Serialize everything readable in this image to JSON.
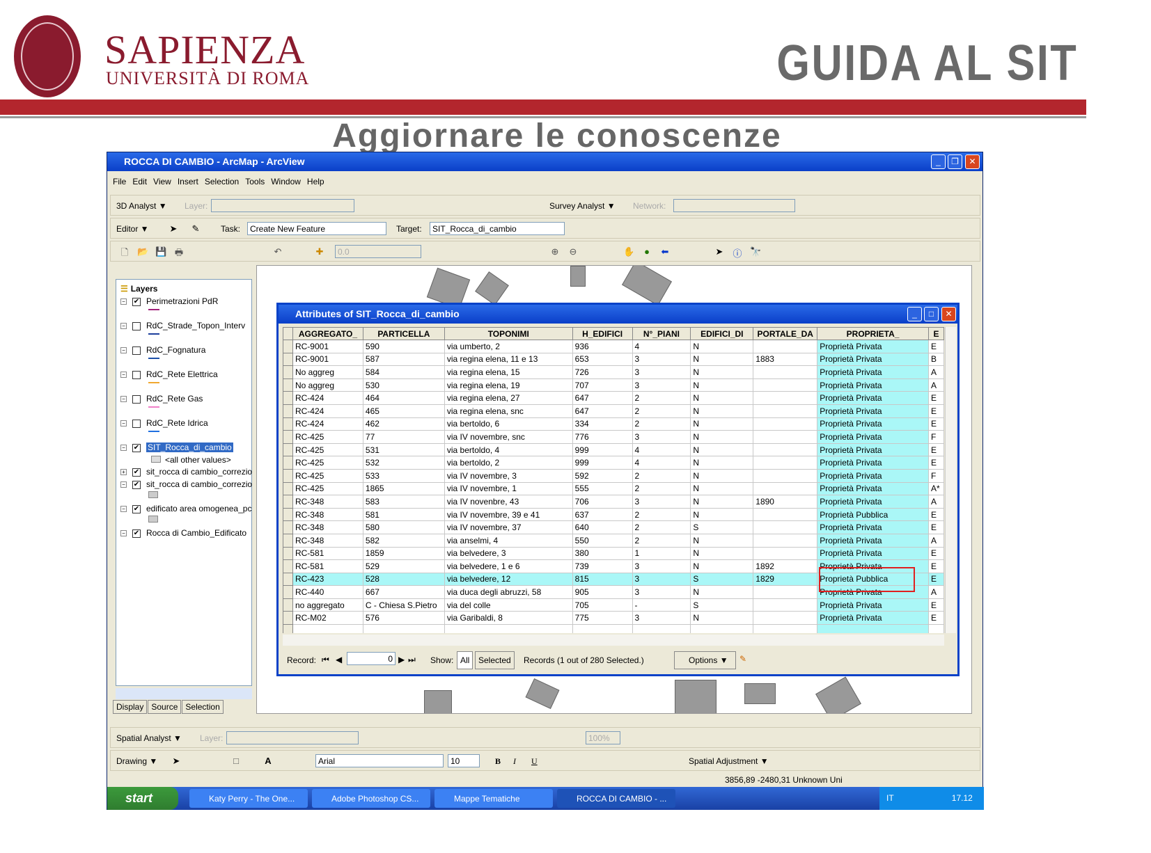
{
  "header": {
    "brand_line1": "SAPIENZA",
    "brand_line2": "UNIVERSITÀ DI ROMA",
    "logo_text": "SAPIENZA STVDIVM VRBIS",
    "guide_title": "GUIDA AL SIT",
    "subtitle": "Aggiornare le conoscenze",
    "accent": "#b3262d"
  },
  "window": {
    "title": "ROCCA DI CAMBIO - ArcMap - ArcView",
    "menu": [
      "File",
      "Edit",
      "View",
      "Insert",
      "Selection",
      "Tools",
      "Window",
      "Help"
    ],
    "toolbar_3d": {
      "label": "3D Analyst ▼",
      "layer_label": "Layer:",
      "survey": "Survey Analyst ▼",
      "network_label": "Network:"
    },
    "toolbar_editor": {
      "label": "Editor ▼",
      "task_label": "Task:",
      "task_value": "Create New Feature",
      "target_label": "Target:",
      "target_value": "SIT_Rocca_di_cambio"
    },
    "toolbar_standard": {
      "scale_value": "0.0"
    },
    "toolbar_spatial": {
      "label": "Spatial Analyst ▼",
      "layer_label": "Layer:",
      "zoom": "100%"
    },
    "toolbar_drawing": {
      "label": "Drawing ▼",
      "font": "Arial",
      "size": "10",
      "bold": "B",
      "italic": "I",
      "underline": "U",
      "spatial_adj": "Spatial Adjustment ▼"
    },
    "status": "3856,89  -2480,31 Unknown Uni"
  },
  "toc": {
    "title": "Layers",
    "layers": [
      {
        "name": "Perimetrazioni PdR",
        "checked": true,
        "color": "#a0207a"
      },
      {
        "name": "RdC_Strade_Topon_Interv",
        "checked": false,
        "color": "#1d3f9c"
      },
      {
        "name": "RdC_Fognatura",
        "checked": false,
        "color": "#1d4fa8"
      },
      {
        "name": "RdC_Rete Elettrica",
        "checked": false,
        "color": "#f0a830"
      },
      {
        "name": "RdC_Rete Gas",
        "checked": false,
        "color": "#f080c8"
      },
      {
        "name": "RdC_Rete Idrica",
        "checked": false,
        "color": "#2070e0"
      },
      {
        "name": "SIT_Rocca_di_cambio",
        "checked": true,
        "selected": true
      },
      {
        "name": "<all other values>",
        "legend": true
      },
      {
        "name": "sit_rocca di cambio_correzio",
        "checked": true,
        "collapsed": true
      },
      {
        "name": "sit_rocca di cambio_correzio",
        "checked": true
      },
      {
        "name": "edificato area omogenea_pc",
        "checked": true
      },
      {
        "name": "Rocca di Cambio_Edificato",
        "checked": true
      }
    ],
    "tabs": [
      "Display",
      "Source",
      "Selection"
    ]
  },
  "attributes": {
    "title": "Attributes of SIT_Rocca_di_cambio",
    "columns": [
      "AGGREGATO_",
      "PARTICELLA",
      "TOPONIMI",
      "H_EDIFICI",
      "N°_PIANI",
      "EDIFICI_DI",
      "PORTALE_DA",
      "PROPRIETA_",
      "E"
    ],
    "rows": [
      [
        "RC-9001",
        "590",
        "via umberto, 2",
        "936",
        "4",
        "N",
        "",
        "Proprietà Privata",
        "E"
      ],
      [
        "RC-9001",
        "587",
        "via regina elena, 11 e 13",
        "653",
        "3",
        "N",
        "1883",
        "Proprietà Privata",
        "B"
      ],
      [
        "No aggreg",
        "584",
        "via regina elena, 15",
        "726",
        "3",
        "N",
        "",
        "Proprietà Privata",
        "A"
      ],
      [
        "No aggreg",
        "530",
        "via regina elena, 19",
        "707",
        "3",
        "N",
        "",
        "Proprietà Privata",
        "A"
      ],
      [
        "RC-424",
        "464",
        "via regina elena, 27",
        "647",
        "2",
        "N",
        "",
        "Proprietà Privata",
        "E"
      ],
      [
        "RC-424",
        "465",
        "via regina elena, snc",
        "647",
        "2",
        "N",
        "",
        "Proprietà Privata",
        "E"
      ],
      [
        "RC-424",
        "462",
        "via bertoldo, 6",
        "334",
        "2",
        "N",
        "",
        "Proprietà Privata",
        "E"
      ],
      [
        "RC-425",
        "77",
        "via IV novembre, snc",
        "776",
        "3",
        "N",
        "",
        "Proprietà Privata",
        "F"
      ],
      [
        "RC-425",
        "531",
        "via bertoldo, 4",
        "999",
        "4",
        "N",
        "",
        "Proprietà Privata",
        "E"
      ],
      [
        "RC-425",
        "532",
        "via bertoldo, 2",
        "999",
        "4",
        "N",
        "",
        "Proprietà Privata",
        "E"
      ],
      [
        "RC-425",
        "533",
        "via IV novembre, 3",
        "592",
        "2",
        "N",
        "",
        "Proprietà Privata",
        "F"
      ],
      [
        "RC-425",
        "1865",
        "via IV novembre, 1",
        "555",
        "2",
        "N",
        "",
        "Proprietà Privata",
        "A*"
      ],
      [
        "RC-348",
        "583",
        "via IV novenbre, 43",
        "706",
        "3",
        "N",
        "1890",
        "Proprietà Privata",
        "A"
      ],
      [
        "RC-348",
        "581",
        "via IV novembre, 39 e 41",
        "637",
        "2",
        "N",
        "",
        "Proprietà Pubblica",
        "E"
      ],
      [
        "RC-348",
        "580",
        "via IV novembre, 37",
        "640",
        "2",
        "S",
        "",
        "Proprietà Privata",
        "E"
      ],
      [
        "RC-348",
        "582",
        "via anselmi, 4",
        "550",
        "2",
        "N",
        "",
        "Proprietà Privata",
        "A"
      ],
      [
        "RC-581",
        "1859",
        "via belvedere, 3",
        "380",
        "1",
        "N",
        "",
        "Proprietà Privata",
        "E"
      ],
      [
        "RC-581",
        "529",
        "via belvedere, 1 e 6",
        "739",
        "3",
        "N",
        "1892",
        "Proprietà Privata",
        "E"
      ],
      [
        "RC-423",
        "528",
        "via belvedere, 12",
        "815",
        "3",
        "S",
        "1829",
        "Proprietà Pubblica",
        "E"
      ],
      [
        "RC-440",
        "667",
        "via duca degli abruzzi, 58",
        "905",
        "3",
        "N",
        "",
        "Proprietà Privata",
        "A"
      ],
      [
        "no aggregato",
        "C - Chiesa S.Pietro",
        "via del colle",
        "705",
        "-",
        "S",
        "",
        "Proprietà Privata",
        "E"
      ],
      [
        "RC-M02",
        "576",
        "via Garibaldi, 8",
        "775",
        "3",
        "N",
        "",
        "Proprietà Privata",
        "E"
      ]
    ],
    "selected_row": 18,
    "footer": {
      "record_label": "Record:",
      "record_value": "0",
      "show_label": "Show:",
      "all": "All",
      "selected": "Selected",
      "records_text": "Records (1 out of 280 Selected.)",
      "options": "Options ▼"
    },
    "highlight_color": "#aaf7f7"
  },
  "taskbar": {
    "start": "start",
    "tasks": [
      "Katy Perry - The One...",
      "Adobe Photoshop CS...",
      "Mappe Tematiche",
      "ROCCA DI CAMBIO - ..."
    ],
    "lang": "IT",
    "clock": "17.12"
  }
}
